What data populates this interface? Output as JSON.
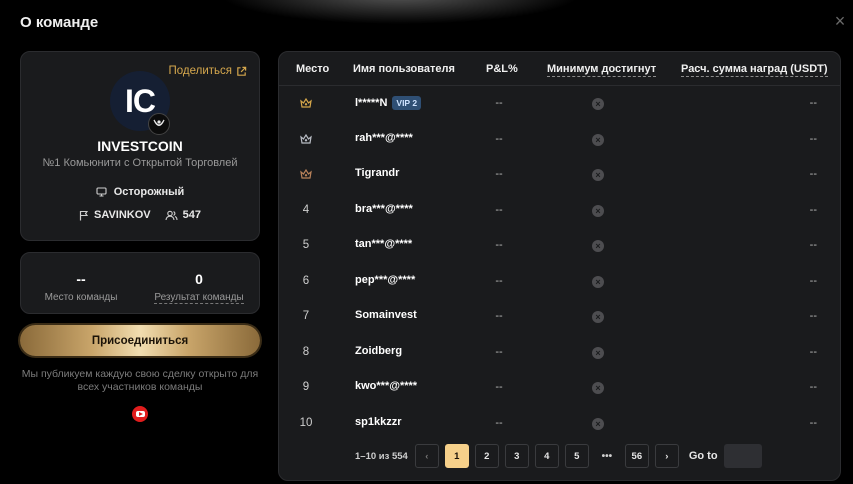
{
  "modal": {
    "title": "О команде",
    "close_icon": "×"
  },
  "team": {
    "share_label": "Поделиться",
    "avatar_text": "IC",
    "name": "INVESTCOIN",
    "description": "№1 Комьюнити с Открытой Торговлей",
    "risk_label": "Осторожный",
    "leader": "SAVINKOV",
    "members": "547"
  },
  "stats": {
    "rank_value": "--",
    "rank_label": "Место команды",
    "result_value": "0",
    "result_label": "Результат команды"
  },
  "join_label": "Присоединиться",
  "note": "Мы публикуем каждую свою сделку открыто для всех участников команды",
  "table": {
    "headers": {
      "rank": "Место",
      "user": "Имя пользователя",
      "pnl": "P&L%",
      "min": "Минимум достигнут",
      "reward": "Расч. сумма наград (USDT)"
    },
    "rows": [
      {
        "rank": "1",
        "medal": "gold",
        "user": "l*****N",
        "vip": "VIP 2",
        "pnl": "--",
        "reward": "--"
      },
      {
        "rank": "2",
        "medal": "silver",
        "user": "rah***@****",
        "vip": "",
        "pnl": "--",
        "reward": "--"
      },
      {
        "rank": "3",
        "medal": "bronze",
        "user": "Tigrandr",
        "vip": "",
        "pnl": "--",
        "reward": "--"
      },
      {
        "rank": "4",
        "medal": "",
        "user": "bra***@****",
        "vip": "",
        "pnl": "--",
        "reward": "--"
      },
      {
        "rank": "5",
        "medal": "",
        "user": "tan***@****",
        "vip": "",
        "pnl": "--",
        "reward": "--"
      },
      {
        "rank": "6",
        "medal": "",
        "user": "pep***@****",
        "vip": "",
        "pnl": "--",
        "reward": "--"
      },
      {
        "rank": "7",
        "medal": "",
        "user": "Somainvest",
        "vip": "",
        "pnl": "--",
        "reward": "--"
      },
      {
        "rank": "8",
        "medal": "",
        "user": "Zoidberg",
        "vip": "",
        "pnl": "--",
        "reward": "--"
      },
      {
        "rank": "9",
        "medal": "",
        "user": "kwo***@****",
        "vip": "",
        "pnl": "--",
        "reward": "--"
      },
      {
        "rank": "10",
        "medal": "",
        "user": "sp1kkzzr",
        "vip": "",
        "pnl": "--",
        "reward": "--"
      }
    ]
  },
  "pagination": {
    "info": "1–10 из 554",
    "prev_icon": "‹",
    "next_icon": "›",
    "pages": [
      "1",
      "2",
      "3",
      "4",
      "5"
    ],
    "active_page": "1",
    "ellipsis": "•••",
    "last_page": "56",
    "goto_label": "Go to",
    "goto_value": ""
  },
  "colors": {
    "accent_gold": "#d6a84d",
    "active_page": "#f6d08a",
    "vip_badge": "#2f4f74",
    "youtube_red": "#e11d1d",
    "medal_gold": "#d4a64a",
    "medal_silver": "#b8bcc4",
    "medal_bronze": "#b9825a"
  }
}
